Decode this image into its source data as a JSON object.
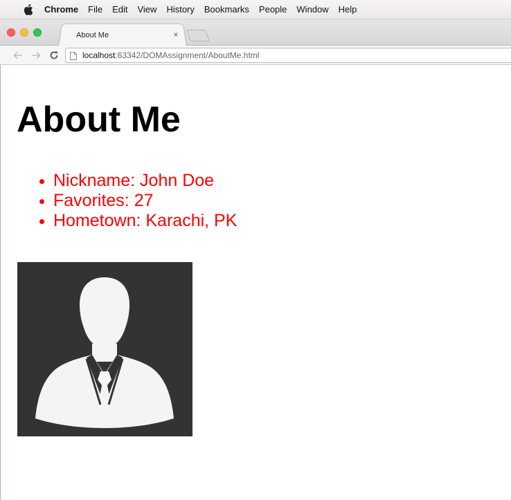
{
  "menubar": {
    "app": "Chrome",
    "items": [
      "File",
      "Edit",
      "View",
      "History",
      "Bookmarks",
      "People",
      "Window",
      "Help"
    ]
  },
  "browser": {
    "tab_title": "About Me",
    "tab_close": "×",
    "url_host": "localhost",
    "url_rest": ":63342/DOMAssignment/AboutMe.html"
  },
  "page": {
    "heading": "About Me",
    "details": [
      "Nickname: John Doe",
      "Favorites: 27",
      "Hometown: Karachi, PK"
    ]
  },
  "colors": {
    "list_text": "#ff0000",
    "avatar_bg": "#333333",
    "avatar_fg": "#f4f4f4"
  },
  "icons": {
    "apple": "apple-icon",
    "back": "back-arrow-icon",
    "forward": "forward-arrow-icon",
    "reload": "reload-icon",
    "page": "page-icon"
  }
}
